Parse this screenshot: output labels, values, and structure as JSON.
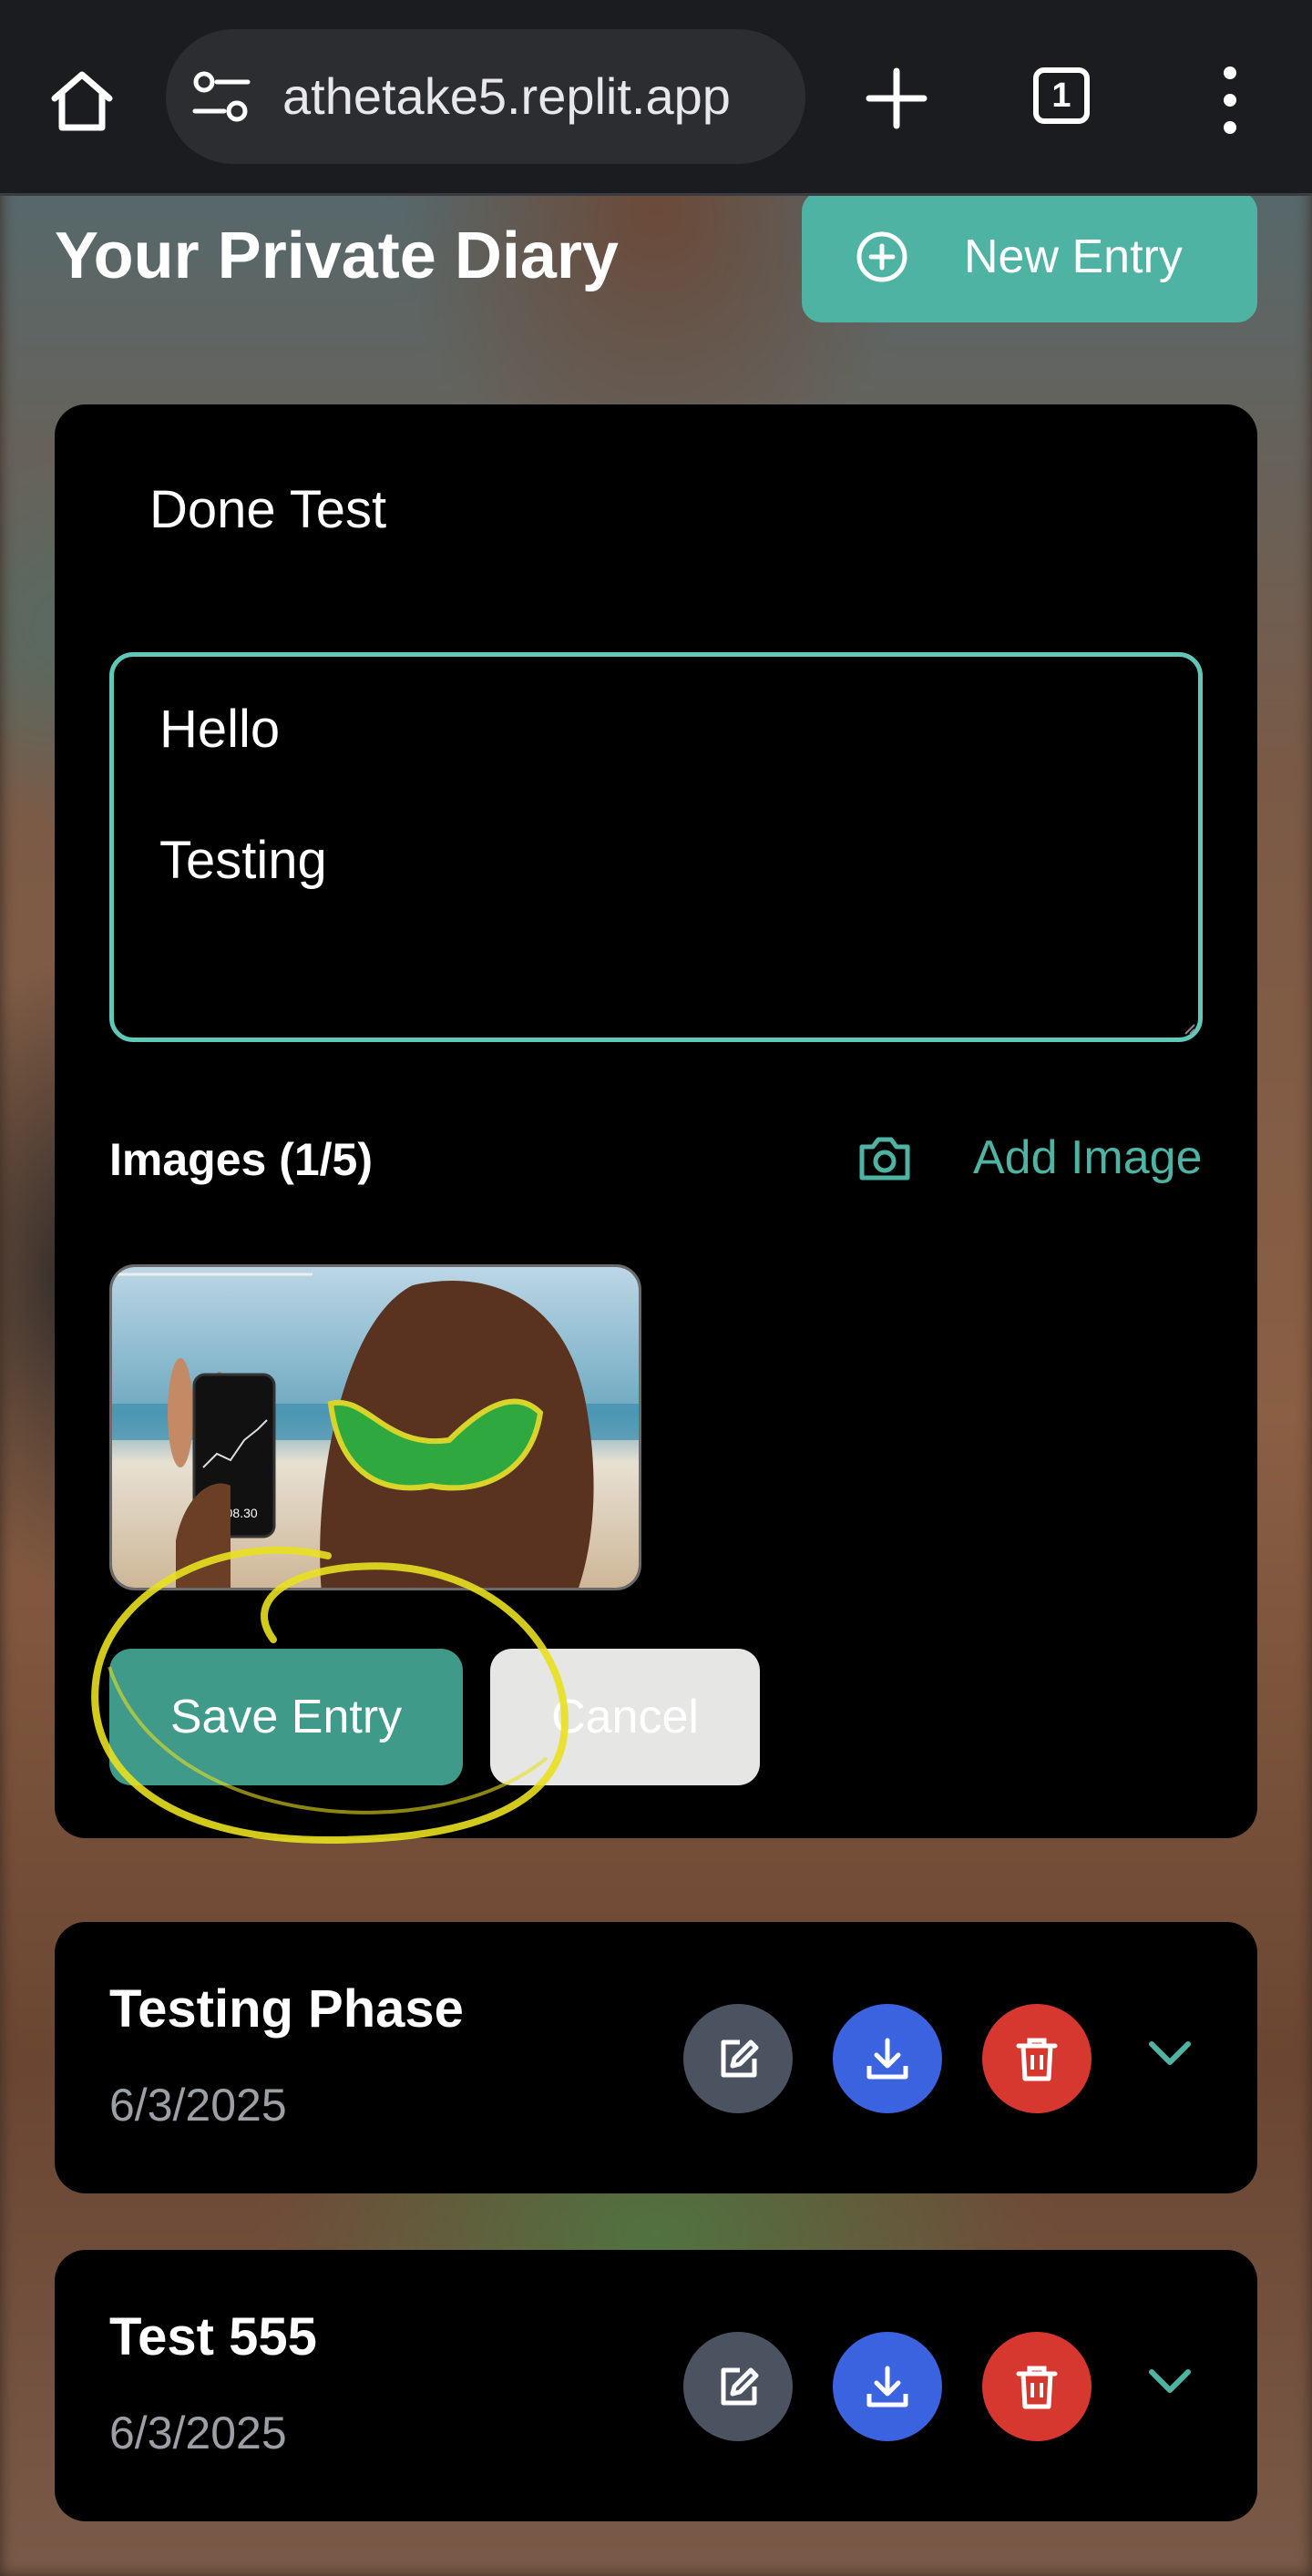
{
  "browser": {
    "url": "athetake5.replit.app",
    "tab_count": "1"
  },
  "header": {
    "title": "Your Private Diary",
    "new_entry_label": "New Entry"
  },
  "editor": {
    "title_value": "Done Test",
    "content_lines": [
      "Hello",
      "",
      "Testing"
    ],
    "images_label": "Images (1/5)",
    "add_image_label": "Add Image",
    "thumbnail_caption": "+1,008.30",
    "save_label": "Save Entry",
    "cancel_label": "Cancel"
  },
  "entries": [
    {
      "title": "Testing Phase",
      "date": "6/3/2025"
    },
    {
      "title": "Test 555",
      "date": "6/3/2025"
    }
  ],
  "colors": {
    "accent": "#4fb3a3",
    "save": "#3f9a8a",
    "edit": "#4b5260",
    "download": "#3b63e0",
    "delete": "#d6382f",
    "highlight": "#e8e020"
  },
  "icons": [
    "home-icon",
    "site-settings-icon",
    "new-tab-icon",
    "tab-count-icon",
    "more-menu-icon",
    "plus-circle-icon",
    "camera-icon",
    "edit-icon",
    "download-icon",
    "trash-icon",
    "chevron-down-icon"
  ]
}
